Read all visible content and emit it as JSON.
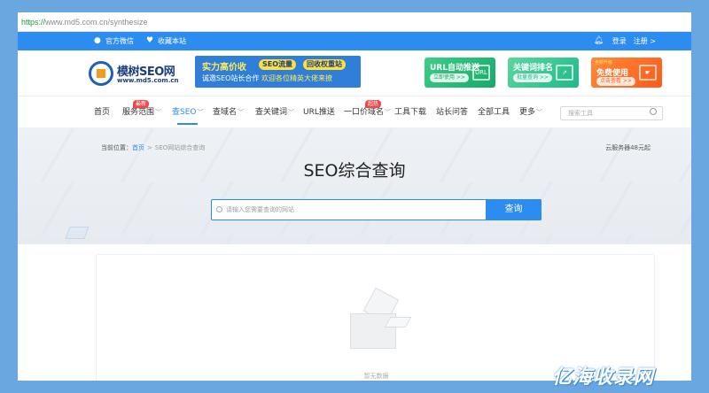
{
  "browser": {
    "url_proto": "https://",
    "url_rest": "www.md5.com.cn/synthesize"
  },
  "topbar": {
    "wechat": "官方微信",
    "bookmark": "收藏本站",
    "login": "登录",
    "register": "注册 >"
  },
  "logo": {
    "name": "模树SEO网",
    "domain": "www.md5.com.cn"
  },
  "banner": {
    "line1": "实力高价收",
    "chip1": "SEO流量",
    "chip2": "回收权重站",
    "line2_prefix": "诚邀SEO站长合作",
    "line2_highlight": "欢迎各位精英大佬来撩"
  },
  "ads": [
    {
      "title": "URL自动推送",
      "button": "立即使用 >>",
      "deco": "URL"
    },
    {
      "title": "关键词排名",
      "button": "批量查询 >>",
      "deco": "↗"
    },
    {
      "pre": "全新升级",
      "title": "免费使用",
      "button": "点击查看 >>",
      "deco": "☛"
    }
  ],
  "nav": {
    "items": [
      {
        "label": "首页"
      },
      {
        "label": "服务范围",
        "caret": "﹀",
        "badge": "最新"
      },
      {
        "label": "查SEO",
        "caret": "﹀"
      },
      {
        "label": "查域名",
        "caret": "﹀"
      },
      {
        "label": "查关键词",
        "caret": "﹀"
      },
      {
        "label": "URL推送"
      },
      {
        "label": "一口价域名",
        "caret": "﹀",
        "badge": "超热"
      },
      {
        "label": "工具下载"
      },
      {
        "label": "站长问答"
      },
      {
        "label": "全部工具"
      },
      {
        "label": "更多",
        "caret": "﹀"
      }
    ],
    "search_placeholder": "搜索工具"
  },
  "hero": {
    "crumb_label": "当前位置：",
    "crumb_home": "首页",
    "crumb_sep": ">",
    "crumb_current": "SEO网站综合查询",
    "cloud": "云服务器48元起",
    "title": "SEO综合查询",
    "input_placeholder": "请输入您需要查询的网站",
    "search_button": "查询"
  },
  "empty": {
    "text": "暂无数据"
  },
  "watermark": "亿海收录网",
  "colors": {
    "accent": "#2d8cf0",
    "hot": "#f04848"
  }
}
